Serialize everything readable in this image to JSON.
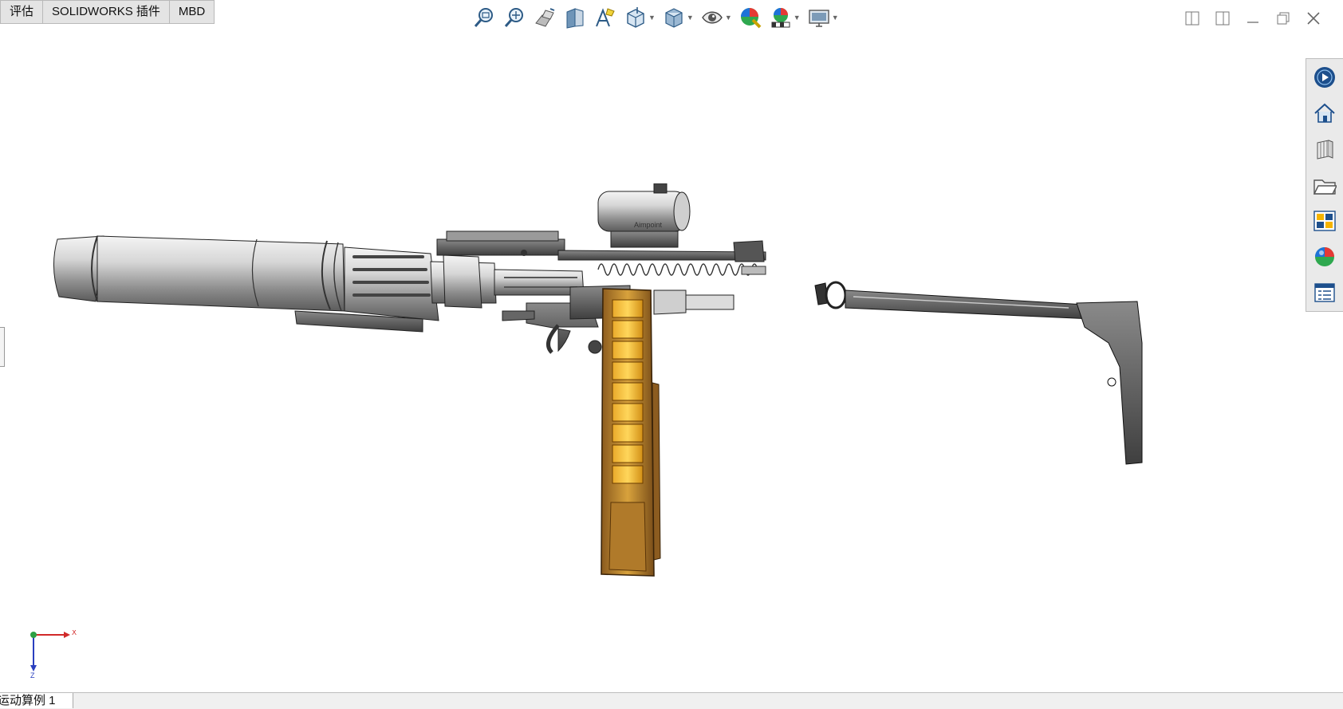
{
  "ribbon": {
    "tabs": [
      {
        "label": "评估"
      },
      {
        "label": "SOLIDWORKS 插件"
      },
      {
        "label": "MBD"
      }
    ]
  },
  "heads_up_toolbar": {
    "tools": [
      "zoom-to-fit-icon",
      "zoom-to-area-icon",
      "previous-view-icon",
      "section-view-icon",
      "dynamic-annotation-icon",
      "view-orientation-icon",
      "display-style-icon",
      "hide-show-items-icon",
      "edit-appearance-icon",
      "apply-scene-icon",
      "view-settings-icon"
    ]
  },
  "window_controls": [
    "tile-left-icon",
    "tile-right-icon",
    "minimize-icon",
    "restore-icon",
    "close-icon"
  ],
  "task_pane": {
    "items": [
      "solidworks-resources-icon",
      "design-library-icon",
      "file-explorer-icon",
      "view-palette-icon",
      "appearances-scenes-icon",
      "custom-properties-icon"
    ]
  },
  "triad": {
    "x_label": "X",
    "z_label": "Z"
  },
  "model": {
    "logo": "Aimpoint"
  },
  "bottom_bar": {
    "motion_tab": "运动算例 1"
  }
}
